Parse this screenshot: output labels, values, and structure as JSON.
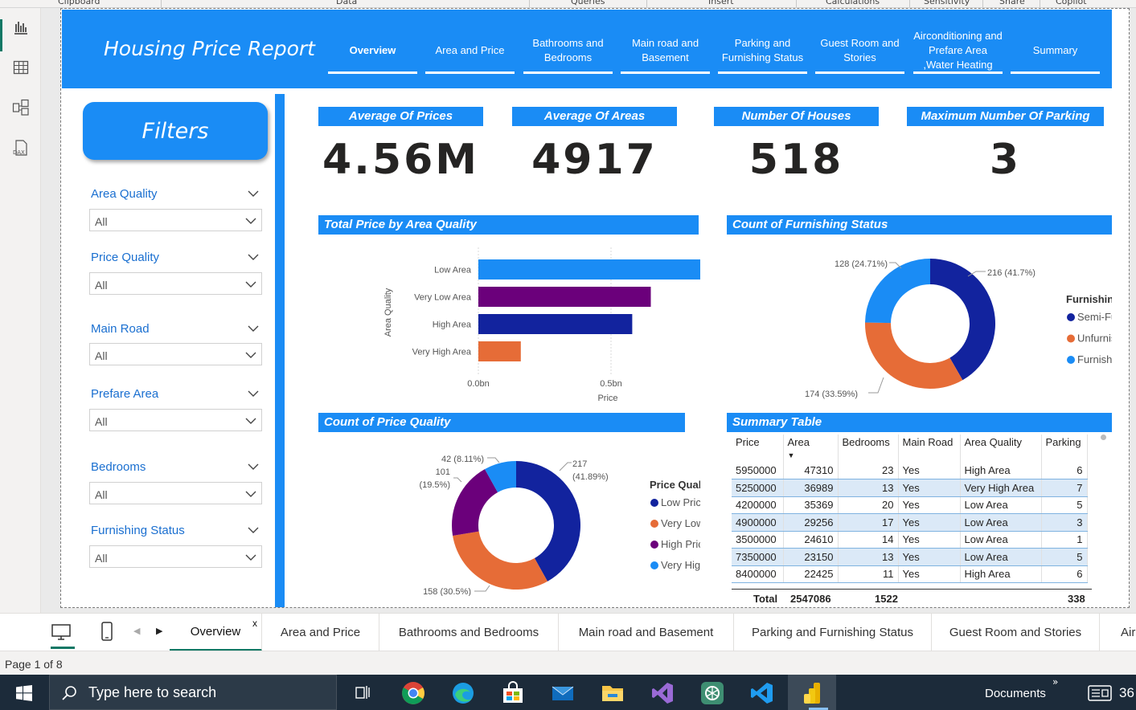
{
  "ribbon": {
    "groups": [
      "Clipboard",
      "Data",
      "Queries",
      "Insert",
      "Calculations",
      "Sensitivity",
      "Share",
      "Copilot"
    ]
  },
  "report": {
    "title": "Housing Price Report",
    "nav": [
      {
        "label": "Overview"
      },
      {
        "label": "Area and Price"
      },
      {
        "label": "Bathrooms and Bedrooms"
      },
      {
        "label": "Main road and Basement"
      },
      {
        "label": "Parking and Furnishing Status"
      },
      {
        "label": "Guest Room and Stories"
      },
      {
        "label": "Airconditioning and Prefare Area ,Water Heating"
      },
      {
        "label": "Summary"
      }
    ]
  },
  "filters": {
    "title": "Filters",
    "items": [
      {
        "label": "Area Quality",
        "value": "All"
      },
      {
        "label": "Price Quality",
        "value": "All"
      },
      {
        "label": "Main Road",
        "value": "All"
      },
      {
        "label": "Prefare Area",
        "value": "All"
      },
      {
        "label": "Bedrooms",
        "value": "All"
      },
      {
        "label": "Furnishing Status",
        "value": "All"
      }
    ]
  },
  "kpis": [
    {
      "title": "Average Of Prices",
      "value": "4.56M"
    },
    {
      "title": "Average Of Areas",
      "value": "4917"
    },
    {
      "title": "Number Of Houses",
      "value": "518"
    },
    {
      "title": "Maximum Number Of Parking",
      "value": "3"
    }
  ],
  "chart_data": [
    {
      "type": "bar",
      "orientation": "horizontal",
      "title": "Total Price by Area Quality",
      "xlabel": "Price",
      "ylabel": "Area Quality",
      "categories": [
        "Low Area",
        "Very Low Area",
        "High Area",
        "Very High Area"
      ],
      "values": [
        0.98,
        0.65,
        0.58,
        0.16
      ],
      "value_unit": "bn",
      "colors": [
        "#1a8cf5",
        "#6b007b",
        "#12239e",
        "#e66c37"
      ],
      "xlim": [
        0,
        1.0
      ],
      "xticks": [
        "0.0bn",
        "0.5bn",
        "1.0bn"
      ]
    },
    {
      "type": "pie",
      "style": "donut",
      "title": "Count of Furnishing Status",
      "legend_title": "Furnishing Status",
      "categories": [
        "Semi-Furnished",
        "Unfurnished",
        "Furnished"
      ],
      "values": [
        216,
        174,
        128
      ],
      "labels": [
        "216 (41.7%)",
        "174 (33.59%)",
        "128 (24.71%)"
      ],
      "colors": [
        "#12239e",
        "#e66c37",
        "#1a8cf5"
      ]
    },
    {
      "type": "pie",
      "style": "donut",
      "title": "Count of Price Quality",
      "legend_title": "Price Quality",
      "categories": [
        "Low Price",
        "Very Low Price",
        "High Price",
        "Very High Price"
      ],
      "values": [
        217,
        158,
        101,
        42
      ],
      "labels": [
        "217 (41.89%)",
        "158 (30.5%)",
        "101 (19.5%)",
        "42 (8.11%)"
      ],
      "colors": [
        "#12239e",
        "#e66c37",
        "#6b007b",
        "#1a8cf5"
      ]
    },
    {
      "type": "table",
      "title": "Summary Table",
      "columns": [
        "Price",
        "Area",
        "Bedrooms",
        "Main Road",
        "Area Quality",
        "Parking"
      ],
      "rows": [
        [
          "5950000",
          "47310",
          "23",
          "Yes",
          "High Area",
          "6"
        ],
        [
          "5250000",
          "36989",
          "13",
          "Yes",
          "Very High Area",
          "7"
        ],
        [
          "4200000",
          "35369",
          "20",
          "Yes",
          "Low Area",
          "5"
        ],
        [
          "4900000",
          "29256",
          "17",
          "Yes",
          "Low Area",
          "3"
        ],
        [
          "3500000",
          "24610",
          "14",
          "Yes",
          "Low Area",
          "1"
        ],
        [
          "7350000",
          "23150",
          "13",
          "Yes",
          "Low Area",
          "5"
        ],
        [
          "8400000",
          "22425",
          "11",
          "Yes",
          "High Area",
          "6"
        ]
      ],
      "total": {
        "label": "Total",
        "area": "2547086",
        "bedrooms": "1522",
        "parking": "338"
      }
    }
  ],
  "page_tabs": [
    "Overview",
    "Area and Price",
    "Bathrooms and Bedrooms",
    "Main road and Basement",
    "Parking and Furnishing Status",
    "Guest Room and Stories",
    "Air"
  ],
  "close_glyph": "x",
  "status": {
    "page": "Page 1 of 8"
  },
  "taskbar": {
    "search_placeholder": "Type here to search",
    "documents": "Documents",
    "time_fragment": "36"
  },
  "colors": {
    "accent": "#1a8cf5",
    "dark_blue": "#12239e",
    "orange": "#e66c37",
    "purple": "#6b007b",
    "pbi_green": "#117865"
  }
}
